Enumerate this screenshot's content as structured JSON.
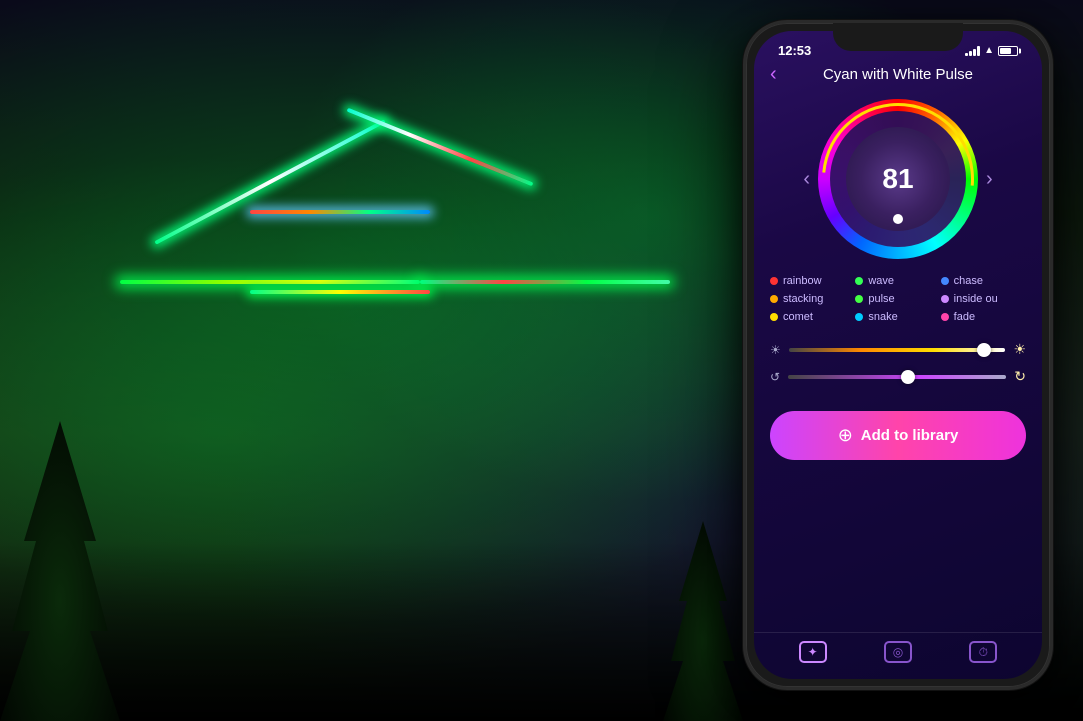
{
  "background": {
    "alt": "House with colorful LED lights at night"
  },
  "phone": {
    "status_bar": {
      "time": "12:53",
      "battery_level": "70%"
    },
    "header": {
      "title": "Cyan with White Pulse",
      "back_label": "‹"
    },
    "wheel": {
      "value": "81",
      "left_arrow": "‹",
      "right_arrow": "›"
    },
    "effects": [
      [
        {
          "label": "rainbow",
          "color": "#ff3333",
          "dot_color": "#ff3333"
        },
        {
          "label": "wave",
          "color": "#33ff55",
          "dot_color": "#33ff55"
        },
        {
          "label": "chase",
          "color": "#4488ff",
          "dot_color": "#4488ff"
        }
      ],
      [
        {
          "label": "stacking",
          "color": "#ffaa00",
          "dot_color": "#ffaa00"
        },
        {
          "label": "pulse",
          "color": "#44ff44",
          "dot_color": "#44ff44"
        },
        {
          "label": "inside ou",
          "color": "#cc88ff",
          "dot_color": "#cc88ff"
        }
      ],
      [
        {
          "label": "comet",
          "color": "#ffdd00",
          "dot_color": "#ffdd00"
        },
        {
          "label": "snake",
          "color": "#00ccff",
          "dot_color": "#00ccff"
        },
        {
          "label": "fade",
          "color": "#ff44aa",
          "dot_color": "#ff44aa"
        }
      ]
    ],
    "sliders": {
      "brightness": {
        "thumb_position": "90%",
        "left_icon": "☀",
        "right_icon": "☀"
      },
      "speed": {
        "thumb_position": "55%",
        "left_icon": "↺",
        "right_icon": "↻"
      }
    },
    "add_to_library_label": "Add to library",
    "add_icon": "⊕",
    "bottom_nav": [
      {
        "label": "",
        "icon": "✦",
        "active": true
      },
      {
        "label": "",
        "icon": "◎",
        "active": false
      },
      {
        "label": "",
        "icon": "⏱",
        "active": false
      }
    ]
  }
}
